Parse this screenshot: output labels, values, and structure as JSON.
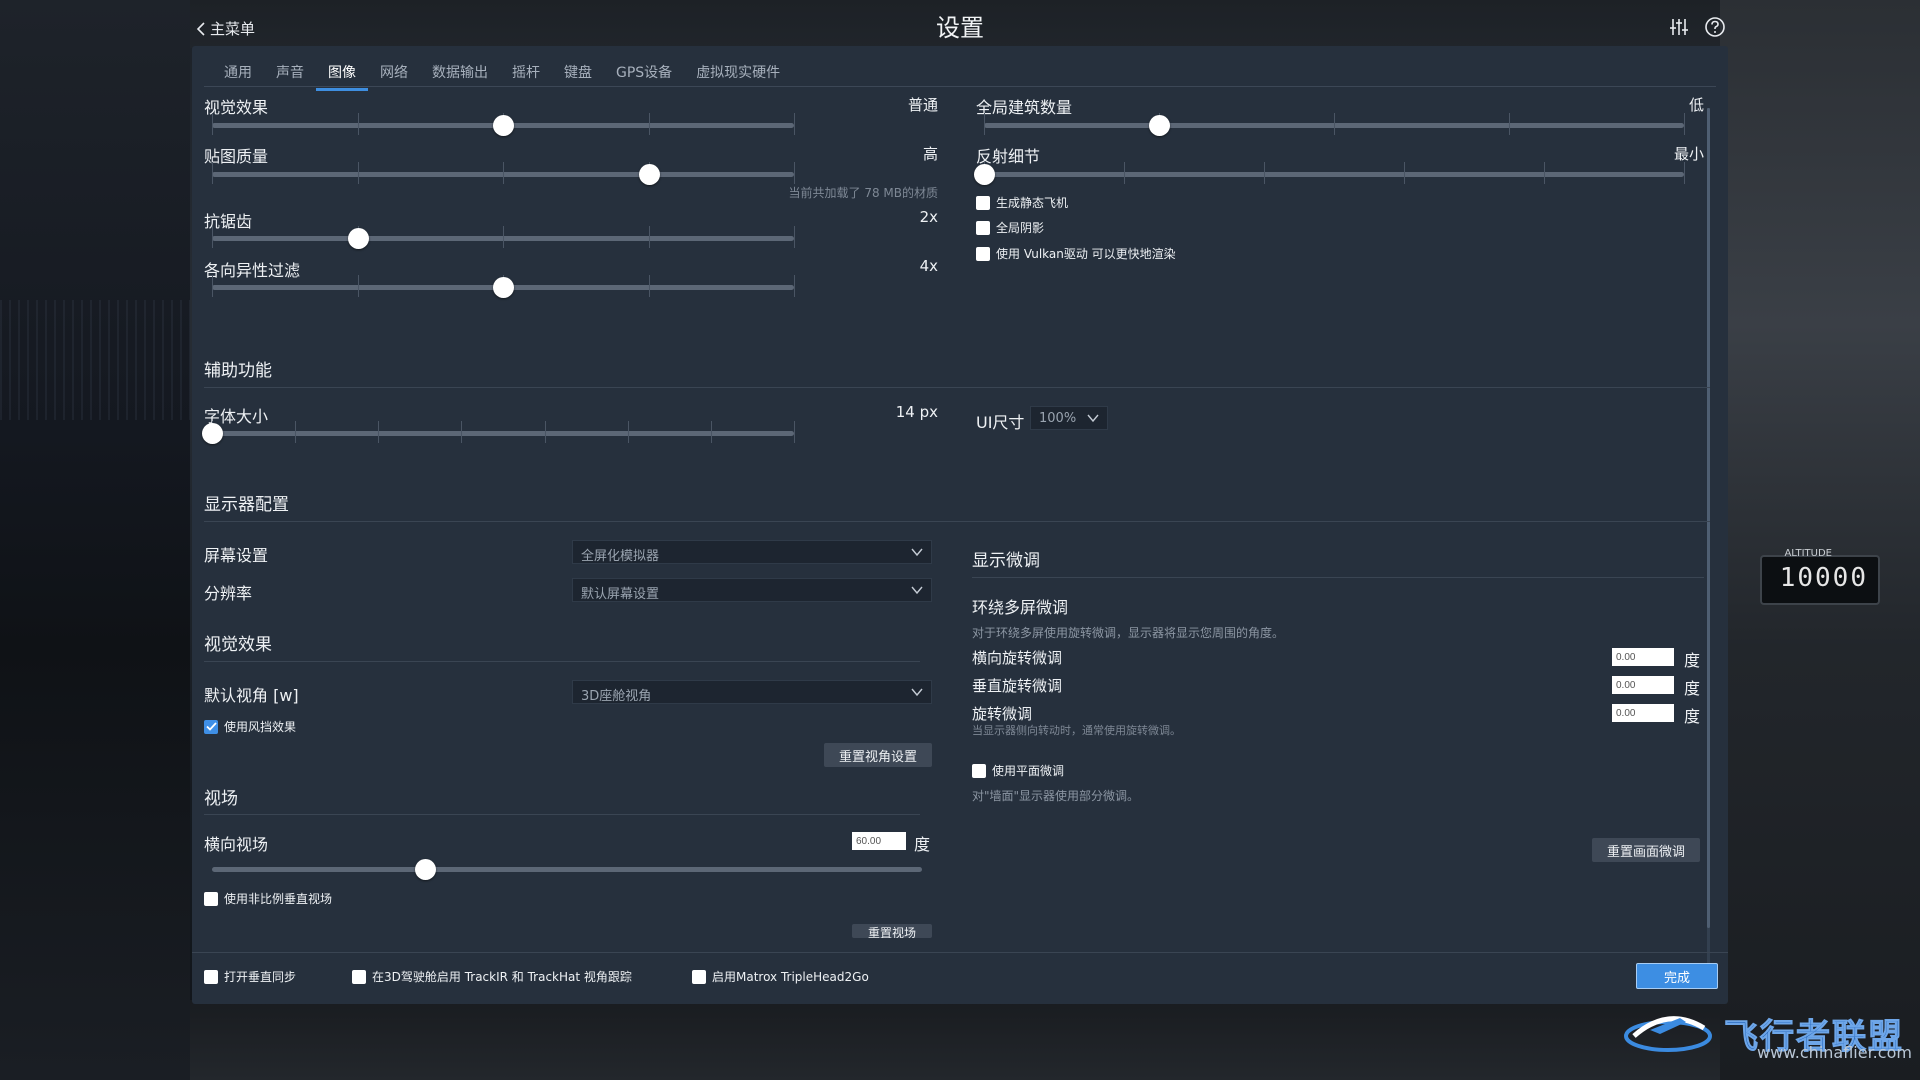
{
  "header": {
    "back_label": "主菜单",
    "title": "设置"
  },
  "tabs": [
    {
      "label": "通用"
    },
    {
      "label": "声音"
    },
    {
      "label": "图像",
      "active": true
    },
    {
      "label": "网络"
    },
    {
      "label": "数据输出"
    },
    {
      "label": "摇杆"
    },
    {
      "label": "键盘"
    },
    {
      "label": "GPS设备"
    },
    {
      "label": "虚拟现实硬件"
    }
  ],
  "graphics": {
    "visual_effects": {
      "label": "视觉效果",
      "value": "普通",
      "level": 0.5
    },
    "texture_quality": {
      "label": "贴图质量",
      "value": "高",
      "level": 0.75,
      "note": "当前共加载了 78 MB的材质"
    },
    "antialiasing": {
      "label": "抗锯齿",
      "value": "2x",
      "level": 0.25
    },
    "anisotropic": {
      "label": "各向异性过滤",
      "value": "4x",
      "level": 0.5
    },
    "world_objects": {
      "label": "全局建筑数量",
      "value": "低",
      "level": 0.25
    },
    "reflection": {
      "label": "反射细节",
      "value": "最小",
      "level": 0.0
    },
    "checkboxes": [
      {
        "label": "生成静态飞机",
        "checked": false
      },
      {
        "label": "全局阴影",
        "checked": false
      },
      {
        "label": "使用 Vulkan驱动 可以更快地渲染",
        "checked": false
      }
    ]
  },
  "accessibility": {
    "section": "辅助功能",
    "font_size": {
      "label": "字体大小",
      "value": "14 px",
      "level": 0.0
    },
    "ui_size": {
      "label": "UI尺寸",
      "value": "100%"
    }
  },
  "monitor": {
    "section": "显示器配置",
    "screen": {
      "label": "屏幕设置",
      "value": "全屏化模拟器"
    },
    "resolution": {
      "label": "分辨率",
      "value": "默认屏幕设置"
    }
  },
  "view": {
    "section": "视觉效果",
    "default_view": {
      "label": "默认视角 [w]",
      "value": "3D座舱视角"
    },
    "windshield": {
      "label": "使用风挡效果",
      "checked": true
    },
    "reset_button": "重置视角设置"
  },
  "fov": {
    "section": "视场",
    "horizontal": {
      "label": "横向视场",
      "value": "60.00",
      "unit": "度",
      "level": 0.3
    },
    "nonproportional": {
      "label": "使用非比例垂直视场",
      "checked": false
    },
    "reset_button": "重置视场"
  },
  "display_tweak": {
    "section": "显示微调",
    "wrap_title": "环绕多屏微调",
    "wrap_note": "对于环绕多屏使用旋转微调，显示器将显示您周围的角度。",
    "lateral": {
      "label": "横向旋转微调",
      "value": "0.00",
      "unit": "度"
    },
    "vertical": {
      "label": "垂直旋转微调",
      "value": "0.00",
      "unit": "度"
    },
    "roll": {
      "label": "旋转微调",
      "value": "0.00",
      "unit": "度",
      "note": "当显示器侧向转动时，通常使用旋转微调。"
    },
    "flat": {
      "label": "使用平面微调",
      "checked": false,
      "note": "对\"墙面\"显示器使用部分微调。"
    },
    "reset_button": "重置画面微调"
  },
  "footer": {
    "vsync": {
      "label": "打开垂直同步",
      "checked": false
    },
    "trackir": {
      "label": "在3D驾驶舱启用 TrackIR 和 TrackHat 视角跟踪",
      "checked": false
    },
    "matrox": {
      "label": "启用Matrox TripleHead2Go",
      "checked": false
    },
    "done_button": "完成"
  },
  "background": {
    "altitude_label": "ALTITUDE",
    "altitude_value": "10000"
  },
  "watermark": {
    "text": "飞行者联盟",
    "url": "www.chinaflier.com"
  },
  "colors": {
    "panel": "#26303d",
    "accent": "#3e8ee0",
    "track": "#5c6776"
  }
}
